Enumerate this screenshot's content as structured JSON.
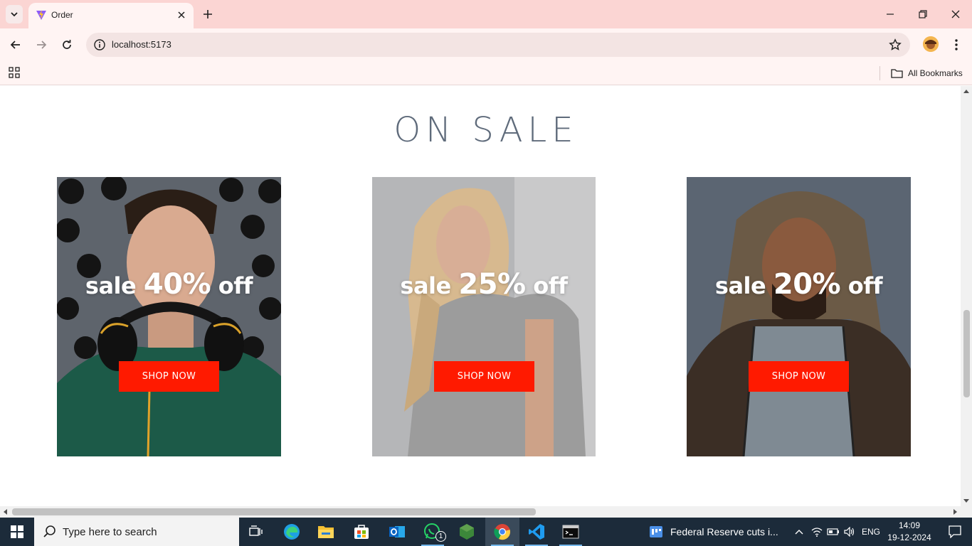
{
  "browser": {
    "tab_title": "Order",
    "url": "localhost:5173",
    "bookmarks_label": "All Bookmarks"
  },
  "page": {
    "heading": "ON SALE",
    "cards": [
      {
        "sale_prefix": "sale",
        "percent": "40%",
        "sale_suffix": "off",
        "button_label": "SHOP NOW"
      },
      {
        "sale_prefix": "sale",
        "percent": "25%",
        "sale_suffix": "off",
        "button_label": "SHOP NOW"
      },
      {
        "sale_prefix": "sale",
        "percent": "20%",
        "sale_suffix": "off",
        "button_label": "SHOP NOW"
      }
    ]
  },
  "taskbar": {
    "search_placeholder": "Type here to search",
    "whatsapp_badge": "1",
    "news_text": "Federal Reserve cuts i...",
    "language": "ENG",
    "time": "14:09",
    "date": "19-12-2024"
  },
  "colors": {
    "tabstrip": "#fbd5d3",
    "heading": "#5f6b7b",
    "shop_button": "#ff1a00",
    "taskbar": "#1c2b3a"
  }
}
